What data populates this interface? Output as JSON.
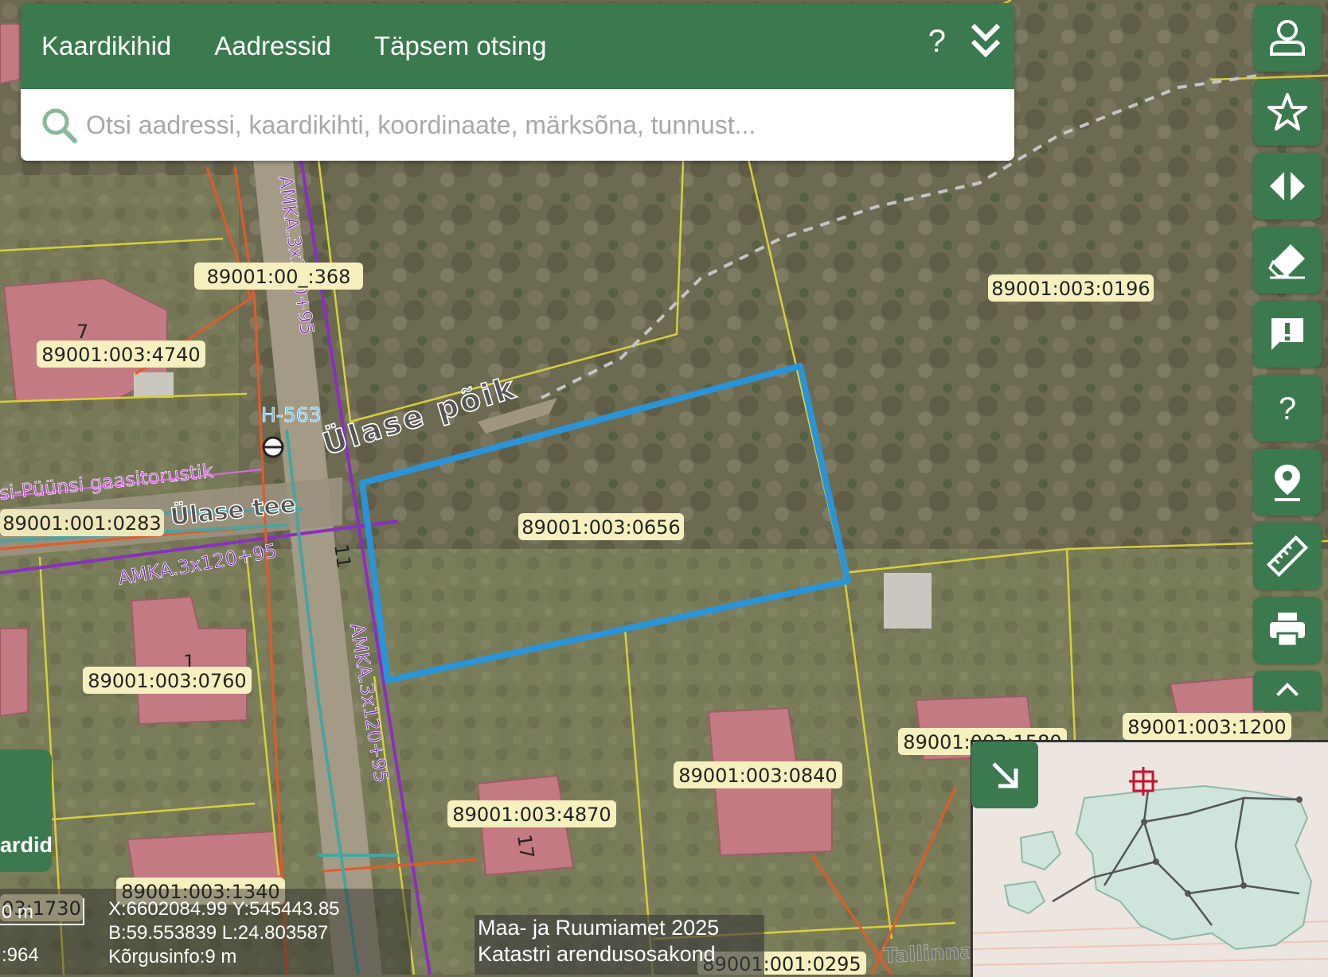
{
  "header": {
    "tabs": [
      {
        "label": "Kaardikihid"
      },
      {
        "label": "Aadressid"
      },
      {
        "label": "Täpsem otsing"
      }
    ],
    "help_label": "?",
    "collapse_icon": "double-chevron-down-icon"
  },
  "search": {
    "placeholder": "Otsi aadressi, kaardikihti, koordinaate, märksõna, tunnust...",
    "value": ""
  },
  "tools": [
    {
      "name": "user-icon"
    },
    {
      "name": "star-icon"
    },
    {
      "name": "compare-icon"
    },
    {
      "name": "eraser-icon"
    },
    {
      "name": "feedback-icon"
    },
    {
      "name": "help-icon"
    },
    {
      "name": "location-pin-icon"
    },
    {
      "name": "ruler-icon"
    },
    {
      "name": "print-icon"
    },
    {
      "name": "chevron-up-icon"
    }
  ],
  "map": {
    "parcels": {
      "p0656": "89001:003:0656",
      "p0196": "89001:003:0196",
      "p4740": "89001:003:4740",
      "p1368": "89001:00_:368",
      "p0760": "89001:003:0760",
      "p0840": "89001:003:0840",
      "p4870": "89001:003:4870",
      "p1340": "89001:003:1340",
      "p1200": "89001:003:1200",
      "p1580": "89001:003:1580",
      "p0283": "89001:001:0283",
      "p0295": "89001:001:0295",
      "p1730": "03:1730"
    },
    "roads": {
      "ulase_poik": "Ülase põik",
      "ulase_tee": "Ülase tee",
      "tallinna": "Tallinna Strateegia"
    },
    "cables": {
      "amka1": "AMKA.3x120+95",
      "amka2": "AMKA.3x120+95",
      "amka3": "AMKA.3x120+95"
    },
    "hydrant": "H-563",
    "gas_pipe": "si-Püünsi gaasitorustik",
    "house_numbers": {
      "n11": "11",
      "n7": "7",
      "n17": "17",
      "n1": "1"
    },
    "highlight_color": "#2a94d6"
  },
  "left_panel": {
    "label": "ardid"
  },
  "scale": {
    "distance": "0 m",
    "ratio": ":964"
  },
  "coordinates": {
    "xy": "X:6602084.99 Y:545443.85",
    "bl": "B:59.553839 L:24.803587",
    "height": "Kõrgusinfo:9 m"
  },
  "attribution": {
    "line1": "Maa- ja Ruumiamet 2025",
    "line2": "Katastri arendusosakond"
  },
  "overview_button_icon": "arrow-down-right-icon"
}
